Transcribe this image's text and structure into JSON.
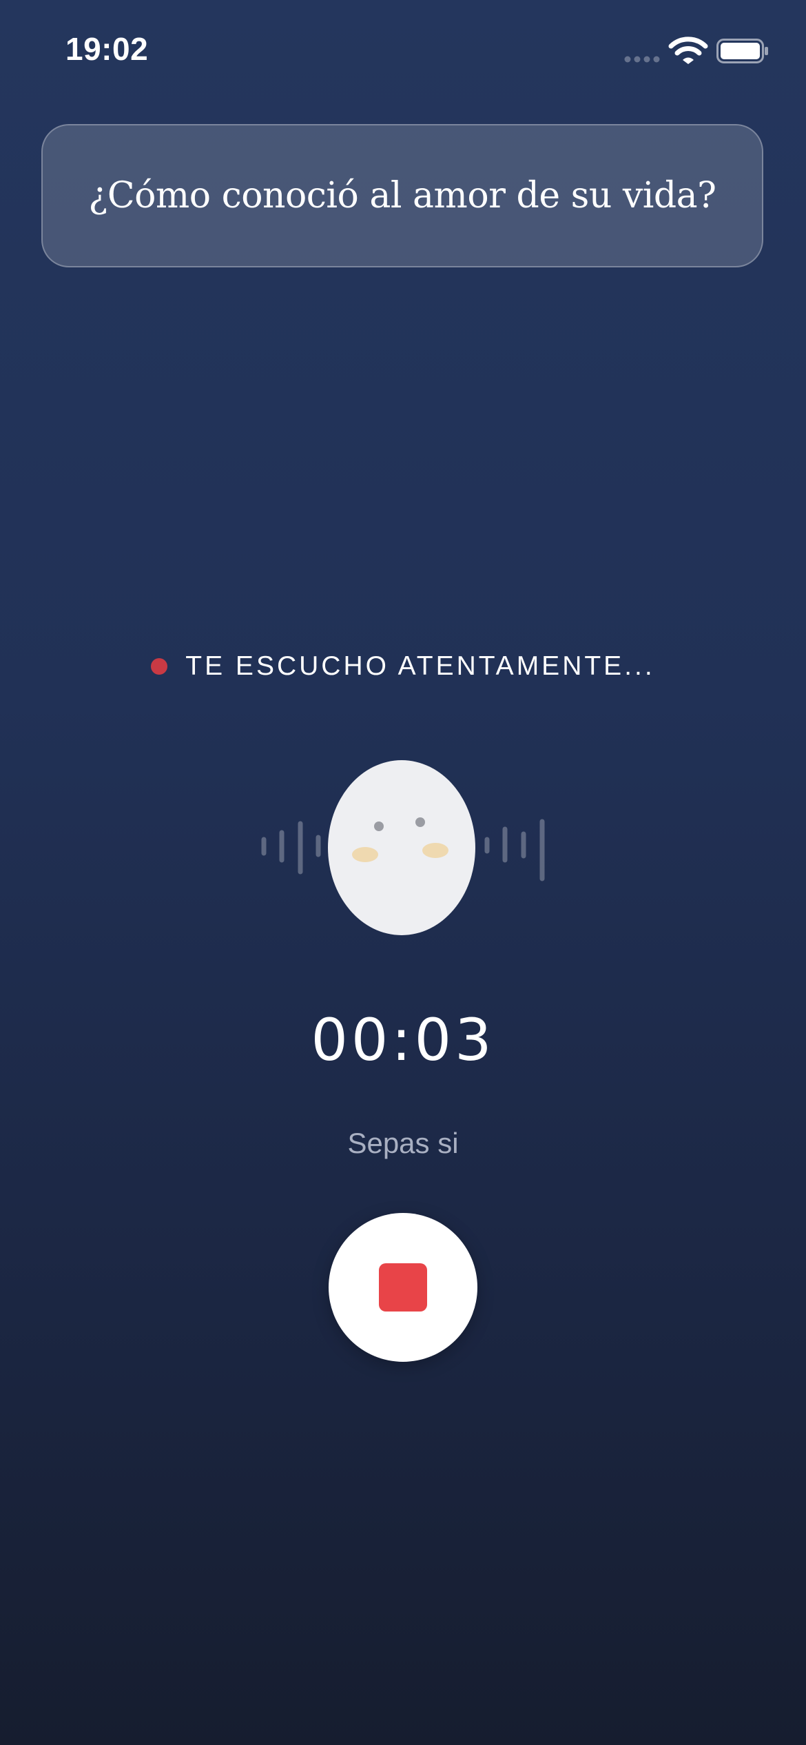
{
  "status_bar": {
    "time": "19:02",
    "icons": [
      "cellular-signal-icon",
      "wifi-icon",
      "battery-icon"
    ]
  },
  "question": {
    "text": "¿Cómo conoció al amor de su vida?"
  },
  "recording": {
    "status_label": "TE ESCUCHO ATENTAMENTE...",
    "indicator_color": "#c93a44",
    "timer": "00:03",
    "transcript": "Sepas si"
  },
  "mascot": {
    "icon": "egg-mascot-icon",
    "waveform_icon": "sound-wave-icon"
  },
  "controls": {
    "stop_icon": "stop-icon",
    "stop_color": "#e84448"
  },
  "colors": {
    "background_top": "#24365d",
    "background_bottom": "#161d2f",
    "accent_red": "#e84448"
  }
}
